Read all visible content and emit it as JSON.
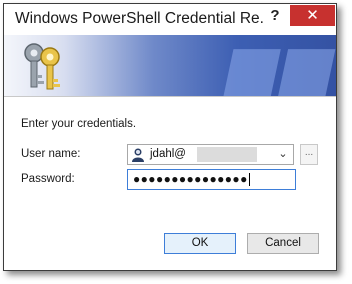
{
  "window": {
    "title": "Windows PowerShell Credential Re...",
    "help_label": "?",
    "close_label": "✕"
  },
  "banner": {
    "icon": "keys-icon",
    "colors": {
      "start": "#f4f6fb",
      "end": "#3452a3"
    }
  },
  "form": {
    "prompt": "Enter your credentials.",
    "username_label": "User name:",
    "username_value": "jdahl@",
    "browse_label": "...",
    "password_label": "Password:",
    "password_mask": "●●●●●●●●●●●●●●●"
  },
  "buttons": {
    "ok_label": "OK",
    "cancel_label": "Cancel"
  },
  "accent_color": "#3e7ed8",
  "close_color": "#c7312f"
}
